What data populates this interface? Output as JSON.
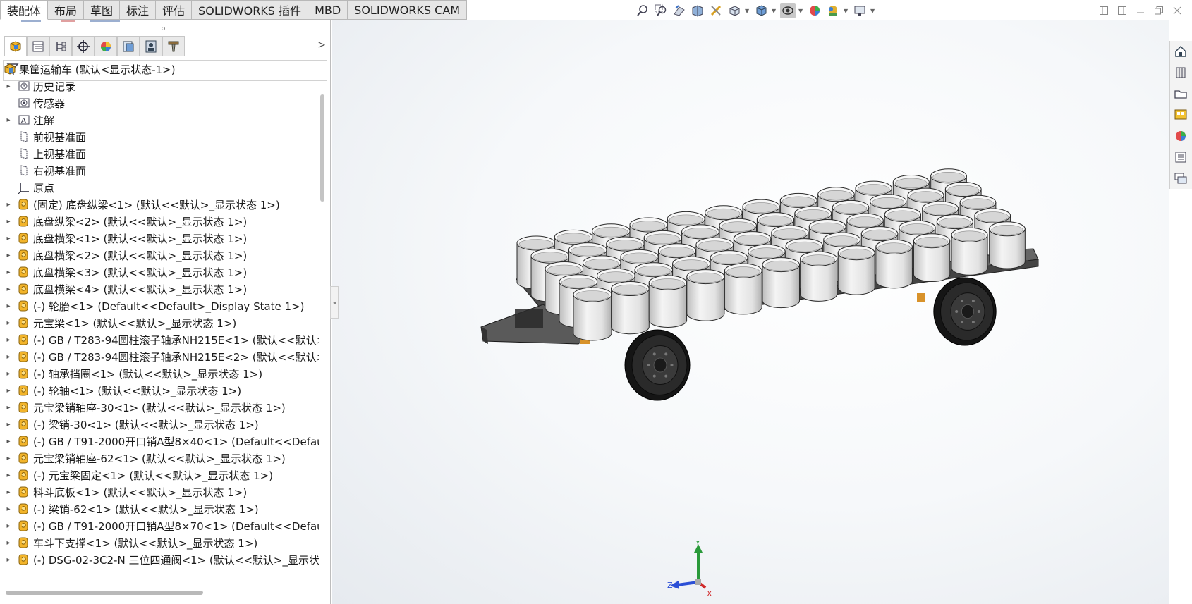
{
  "tabs": [
    {
      "label": "装配体",
      "active": true
    },
    {
      "label": "布局"
    },
    {
      "label": "草图"
    },
    {
      "label": "标注"
    },
    {
      "label": "评估"
    },
    {
      "label": "SOLIDWORKS 插件"
    },
    {
      "label": "MBD"
    },
    {
      "label": "SOLIDWORKS CAM"
    }
  ],
  "view_toolbar": [
    "zoom-to-fit-icon",
    "zoom-to-area-icon",
    "previous-view-icon",
    "section-view-icon",
    "dynamic-annotation-icon",
    "view-orientation-icon",
    "display-style-icon",
    "hide-show-items-icon",
    "edit-appearance-icon",
    "apply-scene-icon",
    "view-settings-icon"
  ],
  "manager_tabs": [
    "featuremanager-tab",
    "propertymanager-tab",
    "configurationmanager-tab",
    "dimxpertmanager-tab",
    "displaymanager-tab",
    "cam-feature-tree-tab",
    "cam-operation-tree-tab",
    "cam-tools-tab"
  ],
  "tree": {
    "root": "果筐运输车 (默认<显示状态-1>)",
    "items": [
      {
        "label": "历史记录",
        "type": "history",
        "arrow": true
      },
      {
        "label": "传感器",
        "type": "sensor",
        "arrow": false
      },
      {
        "label": "注解",
        "type": "annotation",
        "arrow": true
      },
      {
        "label": "前视基准面",
        "type": "plane",
        "arrow": false
      },
      {
        "label": "上视基准面",
        "type": "plane",
        "arrow": false
      },
      {
        "label": "右视基准面",
        "type": "plane",
        "arrow": false
      },
      {
        "label": "原点",
        "type": "origin",
        "arrow": false
      },
      {
        "label": "(固定) 底盘纵梁<1> (默认<<默认>_显示状态 1>)",
        "type": "part",
        "arrow": true
      },
      {
        "label": "底盘纵梁<2> (默认<<默认>_显示状态 1>)",
        "type": "part",
        "arrow": true
      },
      {
        "label": "底盘横梁<1> (默认<<默认>_显示状态 1>)",
        "type": "part",
        "arrow": true
      },
      {
        "label": "底盘横梁<2> (默认<<默认>_显示状态 1>)",
        "type": "part",
        "arrow": true
      },
      {
        "label": "底盘横梁<3> (默认<<默认>_显示状态 1>)",
        "type": "part",
        "arrow": true
      },
      {
        "label": "底盘横梁<4> (默认<<默认>_显示状态 1>)",
        "type": "part",
        "arrow": true
      },
      {
        "label": "(-) 轮胎<1> (Default<<Default>_Display State 1>)",
        "type": "part",
        "arrow": true
      },
      {
        "label": "元宝梁<1> (默认<<默认>_显示状态 1>)",
        "type": "part",
        "arrow": true
      },
      {
        "label": "(-) GB / T283-94圆柱滚子轴承NH215E<1> (默认<<默认>",
        "type": "part",
        "arrow": true
      },
      {
        "label": "(-) GB / T283-94圆柱滚子轴承NH215E<2> (默认<<默认>",
        "type": "part",
        "arrow": true
      },
      {
        "label": "(-) 轴承挡圈<1> (默认<<默认>_显示状态 1>)",
        "type": "part",
        "arrow": true
      },
      {
        "label": "(-) 轮轴<1> (默认<<默认>_显示状态 1>)",
        "type": "part",
        "arrow": true
      },
      {
        "label": "元宝梁销轴座-30<1> (默认<<默认>_显示状态 1>)",
        "type": "part",
        "arrow": true
      },
      {
        "label": "(-) 梁销-30<1> (默认<<默认>_显示状态 1>)",
        "type": "part",
        "arrow": true
      },
      {
        "label": "(-) GB / T91-2000开口销A型8×40<1> (Default<<Default",
        "type": "part",
        "arrow": true
      },
      {
        "label": "元宝梁销轴座-62<1> (默认<<默认>_显示状态 1>)",
        "type": "part",
        "arrow": true
      },
      {
        "label": "(-) 元宝梁固定<1> (默认<<默认>_显示状态 1>)",
        "type": "part",
        "arrow": true
      },
      {
        "label": "料斗底板<1> (默认<<默认>_显示状态 1>)",
        "type": "part",
        "arrow": true
      },
      {
        "label": "(-) 梁销-62<1> (默认<<默认>_显示状态 1>)",
        "type": "part",
        "arrow": true
      },
      {
        "label": "(-) GB / T91-2000开口销A型8×70<1> (Default<<Default",
        "type": "part",
        "arrow": true
      },
      {
        "label": "车斗下支撑<1> (默认<<默认>_显示状态 1>)",
        "type": "part",
        "arrow": true
      },
      {
        "label": "(-) DSG-02-3C2-N 三位四通阀<1> (默认<<默认>_显示状态",
        "type": "part",
        "arrow": true
      }
    ]
  },
  "triad": {
    "x": "X",
    "y": "Y",
    "z": "Z"
  },
  "task_pane": [
    "solidworks-resources-icon",
    "design-library-icon",
    "file-explorer-icon",
    "view-palette-icon",
    "appearances-scenes-icon",
    "custom-properties-icon",
    "forum-icon"
  ],
  "colors": {
    "tab_bg": "#e6e6e6",
    "part_yellow": "#f2b42a",
    "cylinder": "#e4e4e4",
    "frame": "#4a4a4a"
  }
}
